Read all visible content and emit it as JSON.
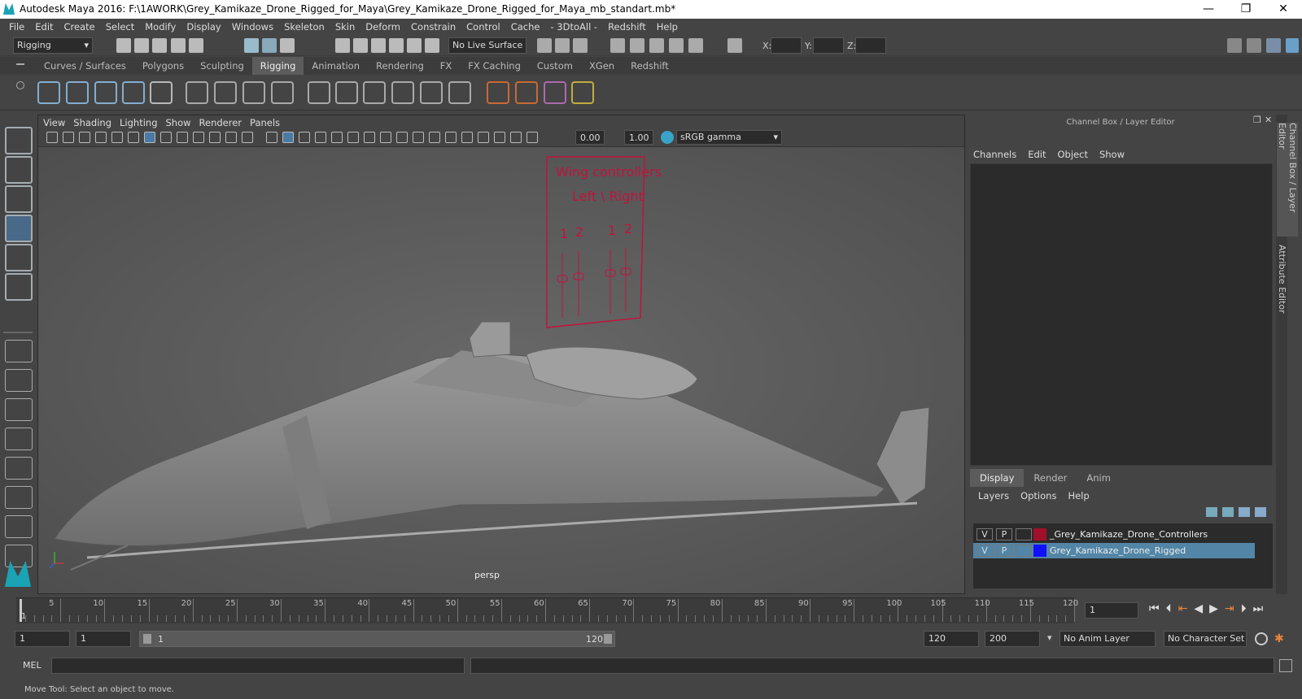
{
  "window": {
    "title": "Autodesk Maya 2016: F:\\1AWORK\\Grey_Kamikaze_Drone_Rigged_for_Maya\\Grey_Kamikaze_Drone_Rigged_for_Maya_mb_standart.mb*",
    "minimize": "—",
    "restore": "❐",
    "close": "✕"
  },
  "menubar": [
    "File",
    "Edit",
    "Create",
    "Select",
    "Modify",
    "Display",
    "Windows",
    "Skeleton",
    "Skin",
    "Deform",
    "Constrain",
    "Control",
    "Cache",
    "- 3DtoAll -",
    "Redshift",
    "Help"
  ],
  "status": {
    "mode": "Rigging",
    "live_surface": "No Live Surface",
    "x_label": "X:",
    "y_label": "Y:",
    "z_label": "Z:"
  },
  "shelf_tabs": [
    "Curves / Surfaces",
    "Polygons",
    "Sculpting",
    "Rigging",
    "Animation",
    "Rendering",
    "FX",
    "FX Caching",
    "Custom",
    "XGen",
    "Redshift"
  ],
  "active_shelf": "Rigging",
  "viewport": {
    "menus": [
      "View",
      "Shading",
      "Lighting",
      "Show",
      "Renderer",
      "Panels"
    ],
    "exposure": "0.00",
    "gamma": "1.00",
    "color_space": "sRGB gamma",
    "camera": "persp"
  },
  "scene": {
    "ctrl_title_1": "Wing controllers",
    "ctrl_title_2": "Left \\ Right",
    "ctrl_labels": [
      "1",
      "2",
      "1",
      "2"
    ]
  },
  "channel_box": {
    "title": "Channel Box / Layer Editor",
    "menus": [
      "Channels",
      "Edit",
      "Object",
      "Show"
    ],
    "side_tabs": [
      "Channel Box / Layer Editor",
      "Attribute Editor"
    ]
  },
  "layer_editor": {
    "tabs": [
      "Display",
      "Render",
      "Anim"
    ],
    "active_tab": "Display",
    "menus": [
      "Layers",
      "Options",
      "Help"
    ],
    "layers": [
      {
        "v": "V",
        "p": "P",
        "color": "#a0102a",
        "name": "_Grey_Kamikaze_Drone_Controllers",
        "selected": false
      },
      {
        "v": "V",
        "p": "P",
        "color": "#1010ff",
        "name": "Grey_Kamikaze_Drone_Rigged",
        "selected": true
      }
    ]
  },
  "timeline": {
    "ticks": [
      "5",
      "10",
      "15",
      "20",
      "25",
      "30",
      "35",
      "40",
      "45",
      "50",
      "55",
      "60",
      "65",
      "70",
      "75",
      "80",
      "85",
      "90",
      "95",
      "100",
      "105",
      "110",
      "115",
      "120"
    ],
    "current_frame": "1",
    "start_marker": "1"
  },
  "range": {
    "start": "1",
    "playback_start": "1",
    "slider_start": "1",
    "slider_end": "120",
    "end": "120",
    "max": "200",
    "anim_layer": "No Anim Layer",
    "character_set": "No Character Set"
  },
  "mel": {
    "label": "MEL"
  },
  "help_line": "Move Tool: Select an object to move."
}
